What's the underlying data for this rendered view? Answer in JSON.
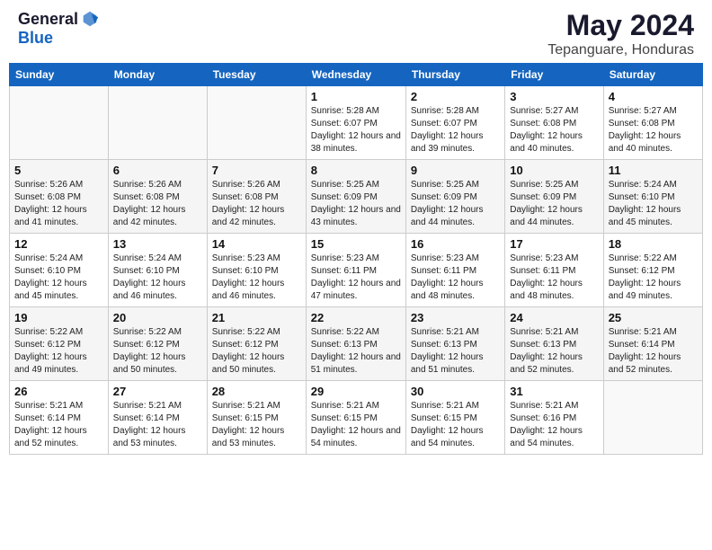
{
  "logo": {
    "general": "General",
    "blue": "Blue",
    "tagline": ""
  },
  "title": "May 2024",
  "subtitle": "Tepanguare, Honduras",
  "days_of_week": [
    "Sunday",
    "Monday",
    "Tuesday",
    "Wednesday",
    "Thursday",
    "Friday",
    "Saturday"
  ],
  "weeks": [
    [
      {
        "day": "",
        "sunrise": "",
        "sunset": "",
        "daylight": ""
      },
      {
        "day": "",
        "sunrise": "",
        "sunset": "",
        "daylight": ""
      },
      {
        "day": "",
        "sunrise": "",
        "sunset": "",
        "daylight": ""
      },
      {
        "day": "1",
        "sunrise": "5:28 AM",
        "sunset": "6:07 PM",
        "daylight": "12 hours and 38 minutes."
      },
      {
        "day": "2",
        "sunrise": "5:28 AM",
        "sunset": "6:07 PM",
        "daylight": "12 hours and 39 minutes."
      },
      {
        "day": "3",
        "sunrise": "5:27 AM",
        "sunset": "6:08 PM",
        "daylight": "12 hours and 40 minutes."
      },
      {
        "day": "4",
        "sunrise": "5:27 AM",
        "sunset": "6:08 PM",
        "daylight": "12 hours and 40 minutes."
      }
    ],
    [
      {
        "day": "5",
        "sunrise": "5:26 AM",
        "sunset": "6:08 PM",
        "daylight": "12 hours and 41 minutes."
      },
      {
        "day": "6",
        "sunrise": "5:26 AM",
        "sunset": "6:08 PM",
        "daylight": "12 hours and 42 minutes."
      },
      {
        "day": "7",
        "sunrise": "5:26 AM",
        "sunset": "6:08 PM",
        "daylight": "12 hours and 42 minutes."
      },
      {
        "day": "8",
        "sunrise": "5:25 AM",
        "sunset": "6:09 PM",
        "daylight": "12 hours and 43 minutes."
      },
      {
        "day": "9",
        "sunrise": "5:25 AM",
        "sunset": "6:09 PM",
        "daylight": "12 hours and 44 minutes."
      },
      {
        "day": "10",
        "sunrise": "5:25 AM",
        "sunset": "6:09 PM",
        "daylight": "12 hours and 44 minutes."
      },
      {
        "day": "11",
        "sunrise": "5:24 AM",
        "sunset": "6:10 PM",
        "daylight": "12 hours and 45 minutes."
      }
    ],
    [
      {
        "day": "12",
        "sunrise": "5:24 AM",
        "sunset": "6:10 PM",
        "daylight": "12 hours and 45 minutes."
      },
      {
        "day": "13",
        "sunrise": "5:24 AM",
        "sunset": "6:10 PM",
        "daylight": "12 hours and 46 minutes."
      },
      {
        "day": "14",
        "sunrise": "5:23 AM",
        "sunset": "6:10 PM",
        "daylight": "12 hours and 46 minutes."
      },
      {
        "day": "15",
        "sunrise": "5:23 AM",
        "sunset": "6:11 PM",
        "daylight": "12 hours and 47 minutes."
      },
      {
        "day": "16",
        "sunrise": "5:23 AM",
        "sunset": "6:11 PM",
        "daylight": "12 hours and 48 minutes."
      },
      {
        "day": "17",
        "sunrise": "5:23 AM",
        "sunset": "6:11 PM",
        "daylight": "12 hours and 48 minutes."
      },
      {
        "day": "18",
        "sunrise": "5:22 AM",
        "sunset": "6:12 PM",
        "daylight": "12 hours and 49 minutes."
      }
    ],
    [
      {
        "day": "19",
        "sunrise": "5:22 AM",
        "sunset": "6:12 PM",
        "daylight": "12 hours and 49 minutes."
      },
      {
        "day": "20",
        "sunrise": "5:22 AM",
        "sunset": "6:12 PM",
        "daylight": "12 hours and 50 minutes."
      },
      {
        "day": "21",
        "sunrise": "5:22 AM",
        "sunset": "6:12 PM",
        "daylight": "12 hours and 50 minutes."
      },
      {
        "day": "22",
        "sunrise": "5:22 AM",
        "sunset": "6:13 PM",
        "daylight": "12 hours and 51 minutes."
      },
      {
        "day": "23",
        "sunrise": "5:21 AM",
        "sunset": "6:13 PM",
        "daylight": "12 hours and 51 minutes."
      },
      {
        "day": "24",
        "sunrise": "5:21 AM",
        "sunset": "6:13 PM",
        "daylight": "12 hours and 52 minutes."
      },
      {
        "day": "25",
        "sunrise": "5:21 AM",
        "sunset": "6:14 PM",
        "daylight": "12 hours and 52 minutes."
      }
    ],
    [
      {
        "day": "26",
        "sunrise": "5:21 AM",
        "sunset": "6:14 PM",
        "daylight": "12 hours and 52 minutes."
      },
      {
        "day": "27",
        "sunrise": "5:21 AM",
        "sunset": "6:14 PM",
        "daylight": "12 hours and 53 minutes."
      },
      {
        "day": "28",
        "sunrise": "5:21 AM",
        "sunset": "6:15 PM",
        "daylight": "12 hours and 53 minutes."
      },
      {
        "day": "29",
        "sunrise": "5:21 AM",
        "sunset": "6:15 PM",
        "daylight": "12 hours and 54 minutes."
      },
      {
        "day": "30",
        "sunrise": "5:21 AM",
        "sunset": "6:15 PM",
        "daylight": "12 hours and 54 minutes."
      },
      {
        "day": "31",
        "sunrise": "5:21 AM",
        "sunset": "6:16 PM",
        "daylight": "12 hours and 54 minutes."
      },
      {
        "day": "",
        "sunrise": "",
        "sunset": "",
        "daylight": ""
      }
    ]
  ],
  "labels": {
    "sunrise_prefix": "Sunrise: ",
    "sunset_prefix": "Sunset: ",
    "daylight_prefix": "Daylight: "
  }
}
